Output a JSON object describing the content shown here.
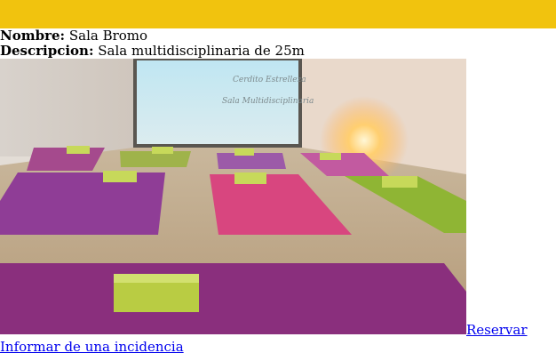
{
  "header": {
    "bar_color": "#f1c30e"
  },
  "room": {
    "name_label": "Nombre:",
    "name": "Sala Bromo",
    "description_label": "Descripcion:",
    "description": "Sala multidisciplinaria de 25m",
    "photo_window_text_1": "Cerdito Estrelleza",
    "photo_window_text_2": "Sala Multidisciplinaria"
  },
  "actions": {
    "reserve_label": "Reservar",
    "incident_label": "Informar de una incidencia"
  }
}
